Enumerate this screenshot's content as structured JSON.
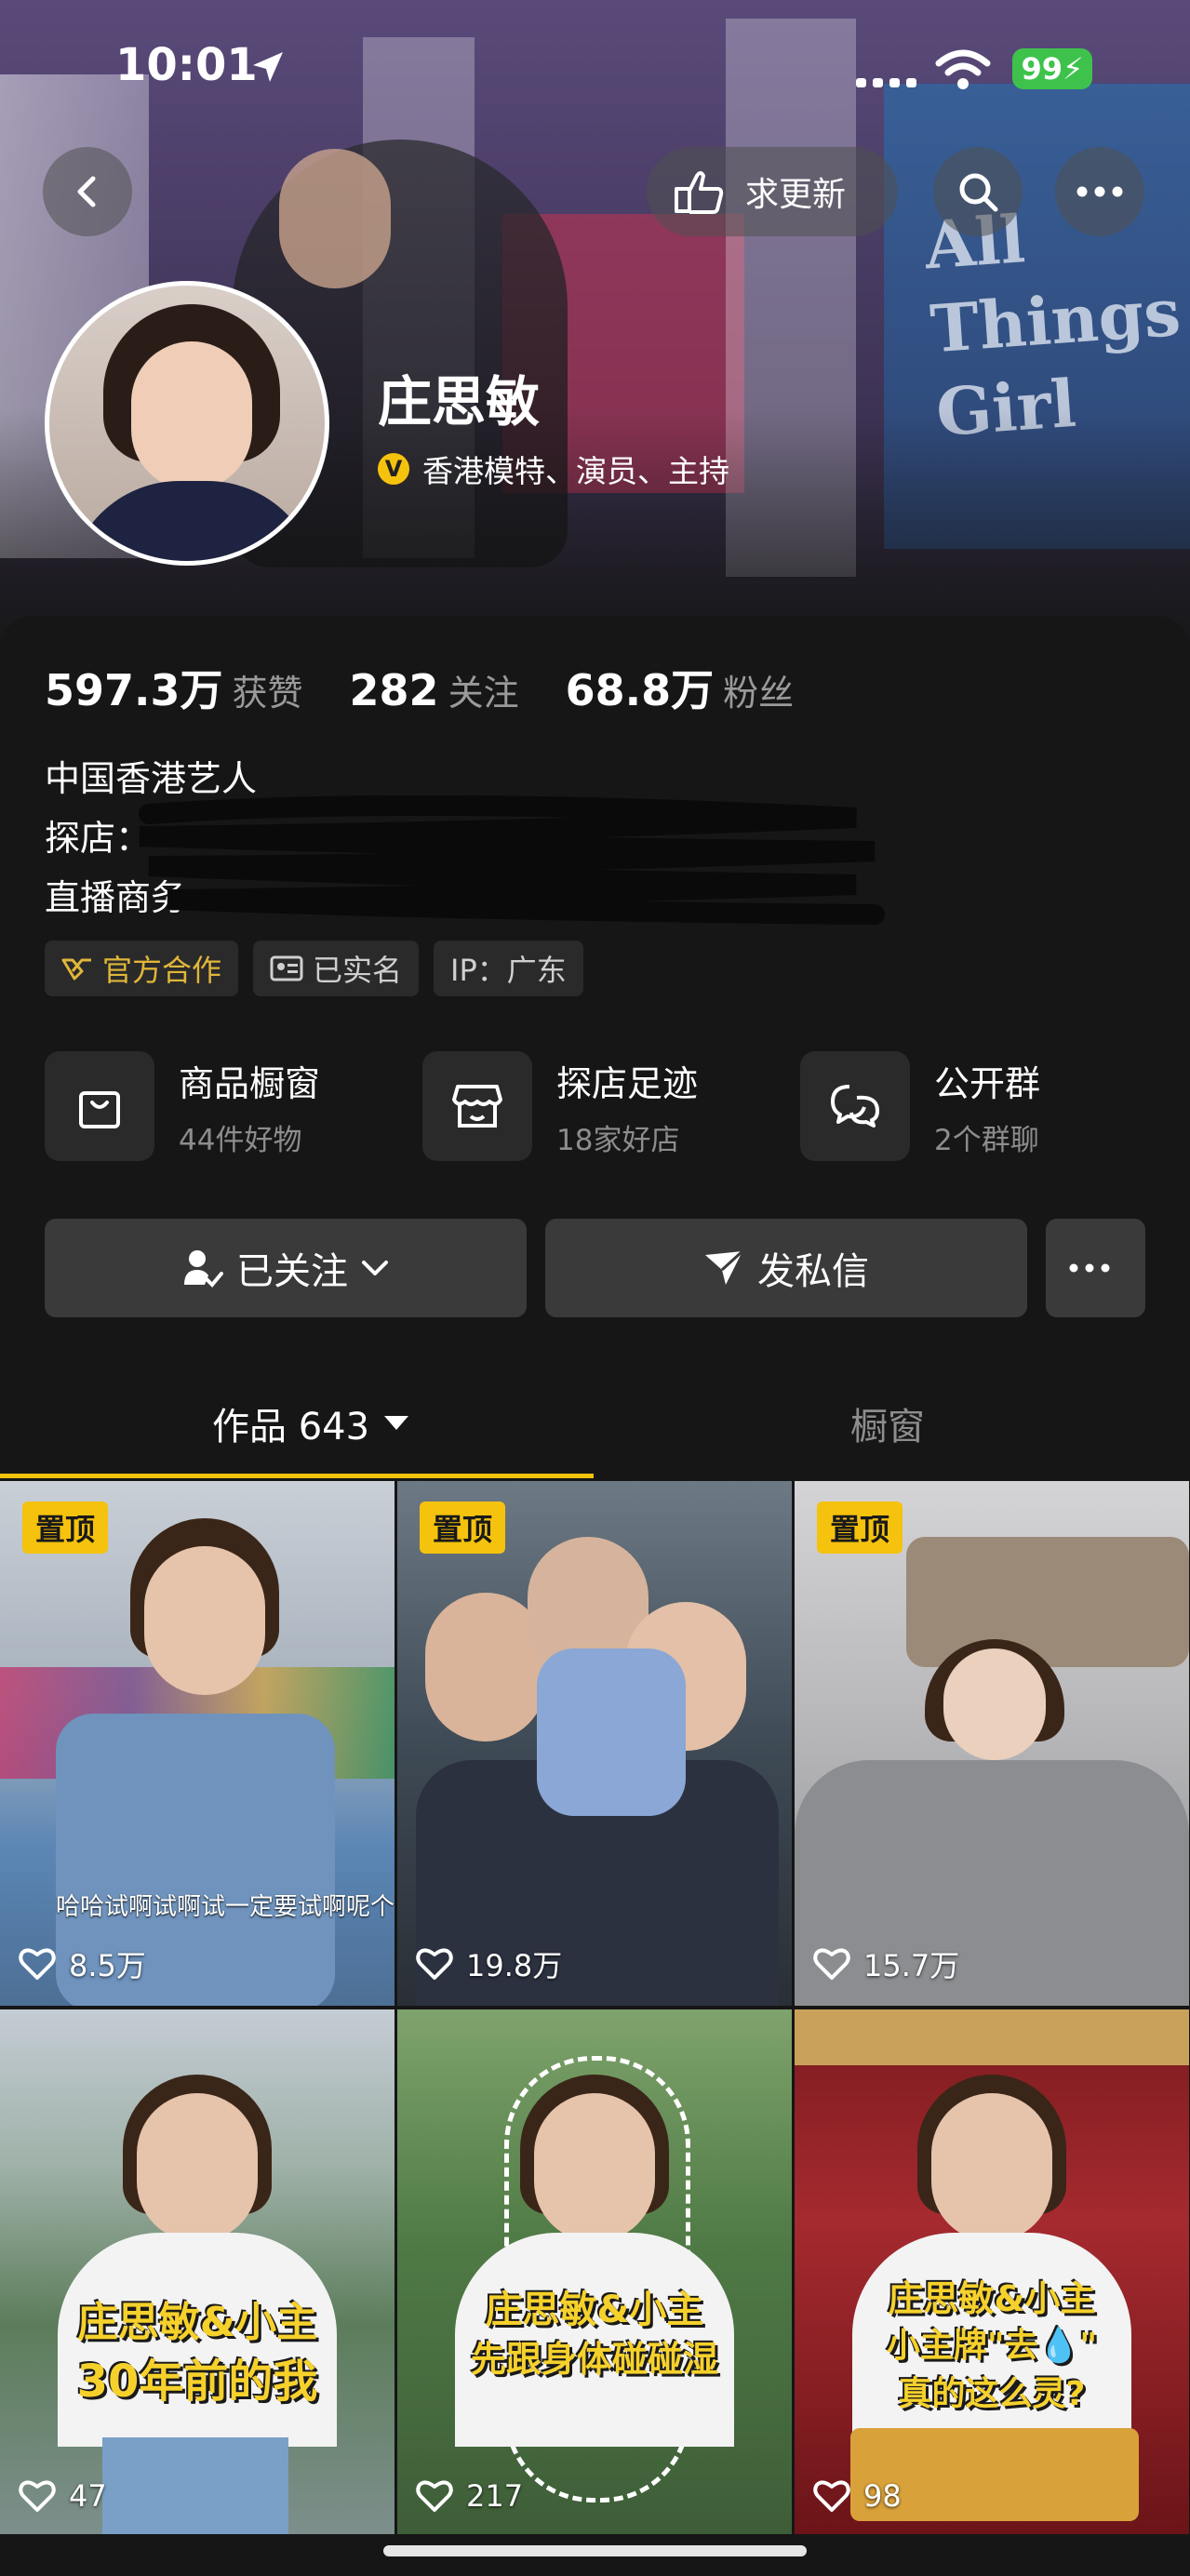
{
  "status_bar": {
    "time": "10:01",
    "battery": "99"
  },
  "header": {
    "update_button_label": "求更新",
    "background_sign": [
      "All",
      "Things",
      "Girl"
    ]
  },
  "profile": {
    "name": "庄思敏",
    "verified_label": "香港模特、演员、主持",
    "verified_badge": "V",
    "stats": {
      "likes_value": "597.3万",
      "likes_label": "获赞",
      "following_value": "282",
      "following_label": "关注",
      "fans_value": "68.8万",
      "fans_label": "粉丝"
    },
    "bio": [
      "中国香港艺人",
      "探店：",
      "直播商务"
    ],
    "tags": [
      "官方合作",
      "已实名",
      "IP：广东"
    ]
  },
  "features": [
    {
      "title": "商品橱窗",
      "subtitle": "44件好物"
    },
    {
      "title": "探店足迹",
      "subtitle": "18家好店"
    },
    {
      "title": "公开群",
      "subtitle": "2个群聊"
    }
  ],
  "actions": {
    "follow_label": "已关注",
    "message_label": "发私信"
  },
  "tabs": {
    "works": "作品 643",
    "showcase": "橱窗"
  },
  "videos": [
    {
      "pinned": "置顶",
      "likes": "8.5万",
      "caption": "哈哈试啊试啊试一定要试啊呢个"
    },
    {
      "pinned": "置顶",
      "likes": "19.8万",
      "caption": ""
    },
    {
      "pinned": "置顶",
      "likes": "15.7万",
      "caption": ""
    },
    {
      "pinned": "",
      "likes": "47",
      "caption_line1": "庄思敏&小主",
      "caption_line2": "30年前的我"
    },
    {
      "pinned": "",
      "likes": "217",
      "caption_line1": "庄思敏&小主",
      "caption_line2": "先跟身体碰碰湿"
    },
    {
      "pinned": "",
      "likes": "98",
      "caption_line1": "庄思敏&小主",
      "caption_line2": "小主牌\"去💧\"",
      "caption_line3": "真的这么灵?"
    }
  ],
  "colors": {
    "accent": "#f5c20e",
    "background": "#161616",
    "battery": "#3ec24c"
  }
}
